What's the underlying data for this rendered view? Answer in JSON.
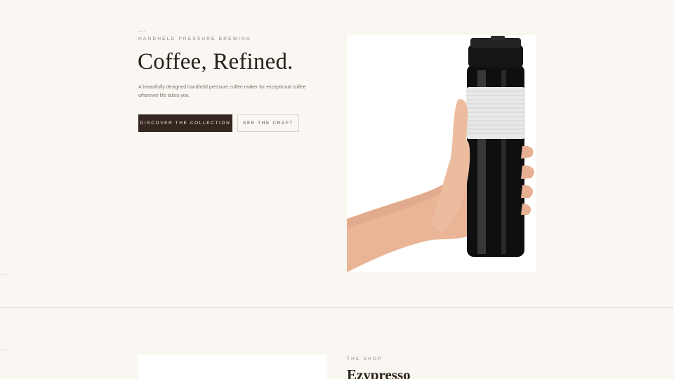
{
  "decor": {
    "dots": "..."
  },
  "hero": {
    "eyebrow": "HANDHELD PRESSURE BREWING",
    "title": "Coffee, Refined.",
    "subtitle": "A beautifully designed handheld pressure coffee maker for exceptional coffee wherever life takes you.",
    "primary_button": "DISCOVER THE COLLECTION",
    "secondary_button": "SEE THE CRAFT",
    "image_icon": "product-photo-hand-holding-black-brewer"
  },
  "shop": {
    "eyebrow": "THE SHOP",
    "title": "Ezypresso"
  },
  "colors": {
    "background": "#faf7f2",
    "primary_button": "#35271f",
    "text": "#2b211b",
    "muted": "#8e857d"
  }
}
